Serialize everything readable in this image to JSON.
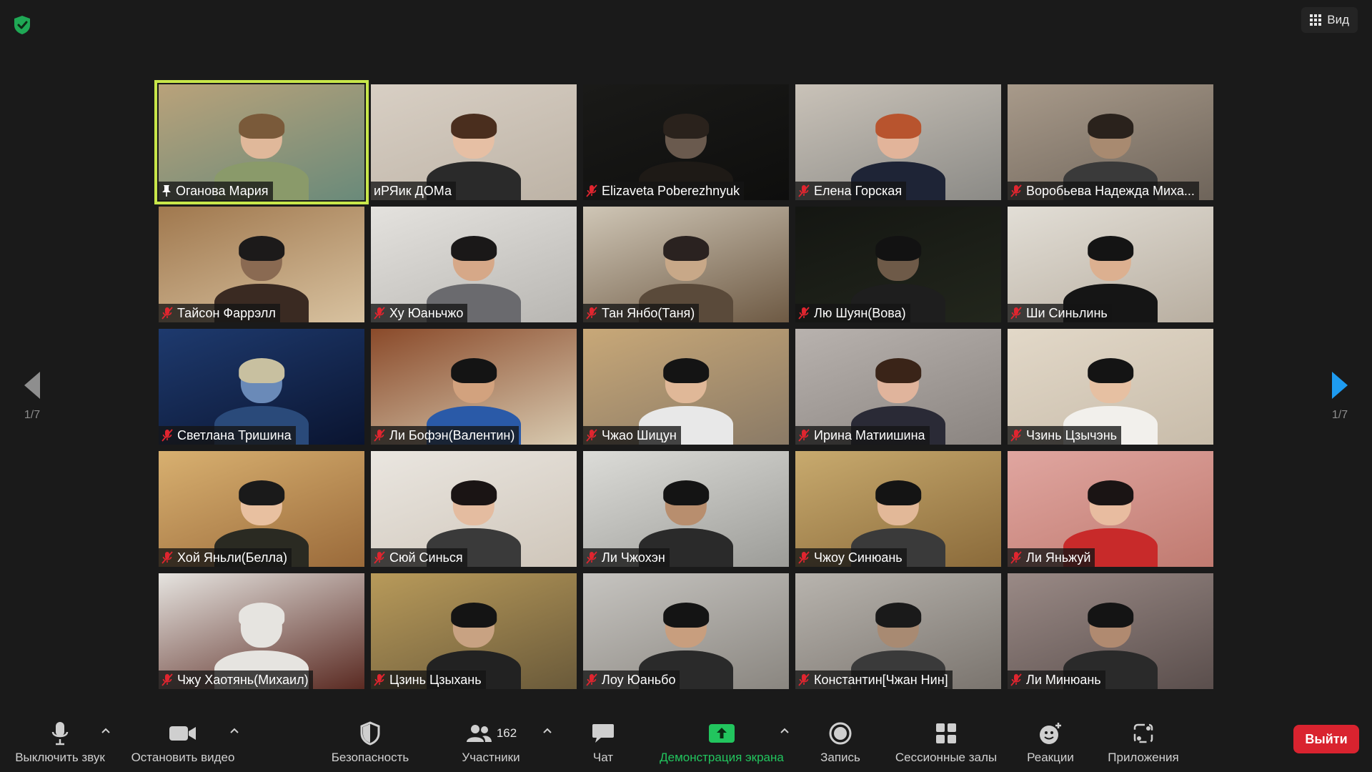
{
  "header": {
    "view_label": "Вид"
  },
  "pager": {
    "left": "1/7",
    "right": "1/7"
  },
  "participants": [
    {
      "name": "Оганова Мария",
      "status": "pinned",
      "active": true,
      "scene": [
        "#b9a27a",
        "#6a8a7a"
      ],
      "skin": "#e0b89a",
      "hair": "#7a5a3a",
      "shirt": "#8a9a6a"
    },
    {
      "name": "иРЯик ДОМа",
      "status": "none",
      "active": false,
      "scene": [
        "#d8cfc4",
        "#bdb3a6"
      ],
      "skin": "#e6bfa4",
      "hair": "#4a2e1e",
      "shirt": "#2a2a2a"
    },
    {
      "name": "Elizaveta Poberezhnyuk",
      "status": "muted",
      "active": false,
      "scene": [
        "#1a1a18",
        "#0e0e0d"
      ],
      "skin": "#6a5a4e",
      "hair": "#2a221c",
      "shirt": "#1e1a16"
    },
    {
      "name": "Елена Горская",
      "status": "muted",
      "active": false,
      "scene": [
        "#c9c2b8",
        "#8b8a86"
      ],
      "skin": "#e2b49a",
      "hair": "#b8542e",
      "shirt": "#1e2436"
    },
    {
      "name": "Воробьева Надежда Миха...",
      "status": "muted",
      "active": false,
      "scene": [
        "#a89a8a",
        "#6e645a"
      ],
      "skin": "#a88a70",
      "hair": "#2a221c",
      "shirt": "#3a3a3a"
    },
    {
      "name": "Тайсон Фаррэлл",
      "status": "muted",
      "active": false,
      "scene": [
        "#a0784e",
        "#d8c2a0"
      ],
      "skin": "#8a6a52",
      "hair": "#1c1a1a",
      "shirt": "#3a2a22"
    },
    {
      "name": "Ху Юаньчжо",
      "status": "muted",
      "active": false,
      "scene": [
        "#e4e2de",
        "#b8b6b2"
      ],
      "skin": "#d6a888",
      "hair": "#1a1818",
      "shirt": "#6a6a6e"
    },
    {
      "name": "Тан Янбо(Таня)",
      "status": "muted",
      "active": false,
      "scene": [
        "#cfc6b6",
        "#6e5a44"
      ],
      "skin": "#c8a888",
      "hair": "#2a2220",
      "shirt": "#5a4a3a"
    },
    {
      "name": "Лю Шуян(Вова)",
      "status": "muted",
      "active": false,
      "scene": [
        "#141612",
        "#22261c"
      ],
      "skin": "#6e5a48",
      "hair": "#121212",
      "shirt": "#1e1e1e"
    },
    {
      "name": "Ши Синьлинь",
      "status": "muted",
      "active": false,
      "scene": [
        "#e2ded6",
        "#b8aea0"
      ],
      "skin": "#dcb090",
      "hair": "#141414",
      "shirt": "#151515"
    },
    {
      "name": "Светлана Тришина",
      "status": "muted",
      "active": false,
      "scene": [
        "#1e3a6e",
        "#0a1430"
      ],
      "skin": "#6a8ab8",
      "hair": "#c8c0a0",
      "shirt": "#2a4a7a"
    },
    {
      "name": "Ли Бофэн(Валентин)",
      "status": "muted",
      "active": false,
      "scene": [
        "#8a4a2a",
        "#d8cab0"
      ],
      "skin": "#d2a27e",
      "hair": "#141414",
      "shirt": "#2a5aa8"
    },
    {
      "name": "Чжао Шицун",
      "status": "muted",
      "active": false,
      "scene": [
        "#c8a878",
        "#8a7a66"
      ],
      "skin": "#e0b898",
      "hair": "#141414",
      "shirt": "#e8e8e8"
    },
    {
      "name": "Ирина Матиишина",
      "status": "muted",
      "active": false,
      "scene": [
        "#b8b2ae",
        "#8a8480"
      ],
      "skin": "#e0b49c",
      "hair": "#3a2418",
      "shirt": "#2a2a36"
    },
    {
      "name": "Чзинь Цзычэнь",
      "status": "muted",
      "active": false,
      "scene": [
        "#e2d8c8",
        "#c8bcaa"
      ],
      "skin": "#e6c0a2",
      "hair": "#141414",
      "shirt": "#f2f0ec"
    },
    {
      "name": "Хой Яньли(Белла)",
      "status": "muted",
      "active": false,
      "scene": [
        "#d8b070",
        "#9a6a3a"
      ],
      "skin": "#e8c0a0",
      "hair": "#1a1a1a",
      "shirt": "#2a2a22"
    },
    {
      "name": "Сюй Синься",
      "status": "muted",
      "active": false,
      "scene": [
        "#eae6e0",
        "#cfc6ba"
      ],
      "skin": "#e4bca0",
      "hair": "#1a1414",
      "shirt": "#3a3a3a"
    },
    {
      "name": "Ли Чжохэн",
      "status": "muted",
      "active": false,
      "scene": [
        "#dcdcd8",
        "#9c9c98"
      ],
      "skin": "#b88e6e",
      "hair": "#141414",
      "shirt": "#2a2a2a"
    },
    {
      "name": "Чжоу Синюань",
      "status": "muted",
      "active": false,
      "scene": [
        "#c8aa6e",
        "#8a6a3a"
      ],
      "skin": "#e2b898",
      "hair": "#141414",
      "shirt": "#3a3a3a"
    },
    {
      "name": "Ли Яньжуй",
      "status": "muted",
      "active": false,
      "scene": [
        "#e0a6a0",
        "#c07a70"
      ],
      "skin": "#e8bca0",
      "hair": "#1a1414",
      "shirt": "#c82a2a"
    },
    {
      "name": "Чжу Хаотянь(Михаил)",
      "status": "muted",
      "active": false,
      "scene": [
        "#e6e4e0",
        "#5a2a22"
      ],
      "skin": "#e6e4e0",
      "hair": "#e6e4e0",
      "shirt": "#e6e4e0"
    },
    {
      "name": "Цзинь Цзыхань",
      "status": "muted",
      "active": false,
      "scene": [
        "#b89a5a",
        "#6a5a3a"
      ],
      "skin": "#c8a282",
      "hair": "#141414",
      "shirt": "#222222"
    },
    {
      "name": "Лоу Юаньбо",
      "status": "muted",
      "active": false,
      "scene": [
        "#c6c4c0",
        "#8a8680"
      ],
      "skin": "#c89e7e",
      "hair": "#141414",
      "shirt": "#2a2a2a"
    },
    {
      "name": "Константин[Чжан  Нин]",
      "status": "muted",
      "active": false,
      "scene": [
        "#b8b4ae",
        "#7a746e"
      ],
      "skin": "#a88a72",
      "hair": "#1a1a1a",
      "shirt": "#3a3a3a"
    },
    {
      "name": "Ли Минюань",
      "status": "muted",
      "active": false,
      "scene": [
        "#9a8a86",
        "#5a4e4c"
      ],
      "skin": "#b08a70",
      "hair": "#141414",
      "shirt": "#2a2a2a"
    }
  ],
  "toolbar": {
    "mute_label": "Выключить звук",
    "video_label": "Остановить видео",
    "security_label": "Безопасность",
    "participants_label": "Участники",
    "participants_count": "162",
    "chat_label": "Чат",
    "share_label": "Демонстрация экрана",
    "record_label": "Запись",
    "breakout_label": "Сессионные залы",
    "reactions_label": "Реакции",
    "apps_label": "Приложения",
    "leave_label": "Выйти"
  },
  "colors": {
    "share_green": "#22c55e",
    "leave_red": "#d9232f",
    "active_speaker": "#c8e64a",
    "muted_red": "#e0252f"
  }
}
